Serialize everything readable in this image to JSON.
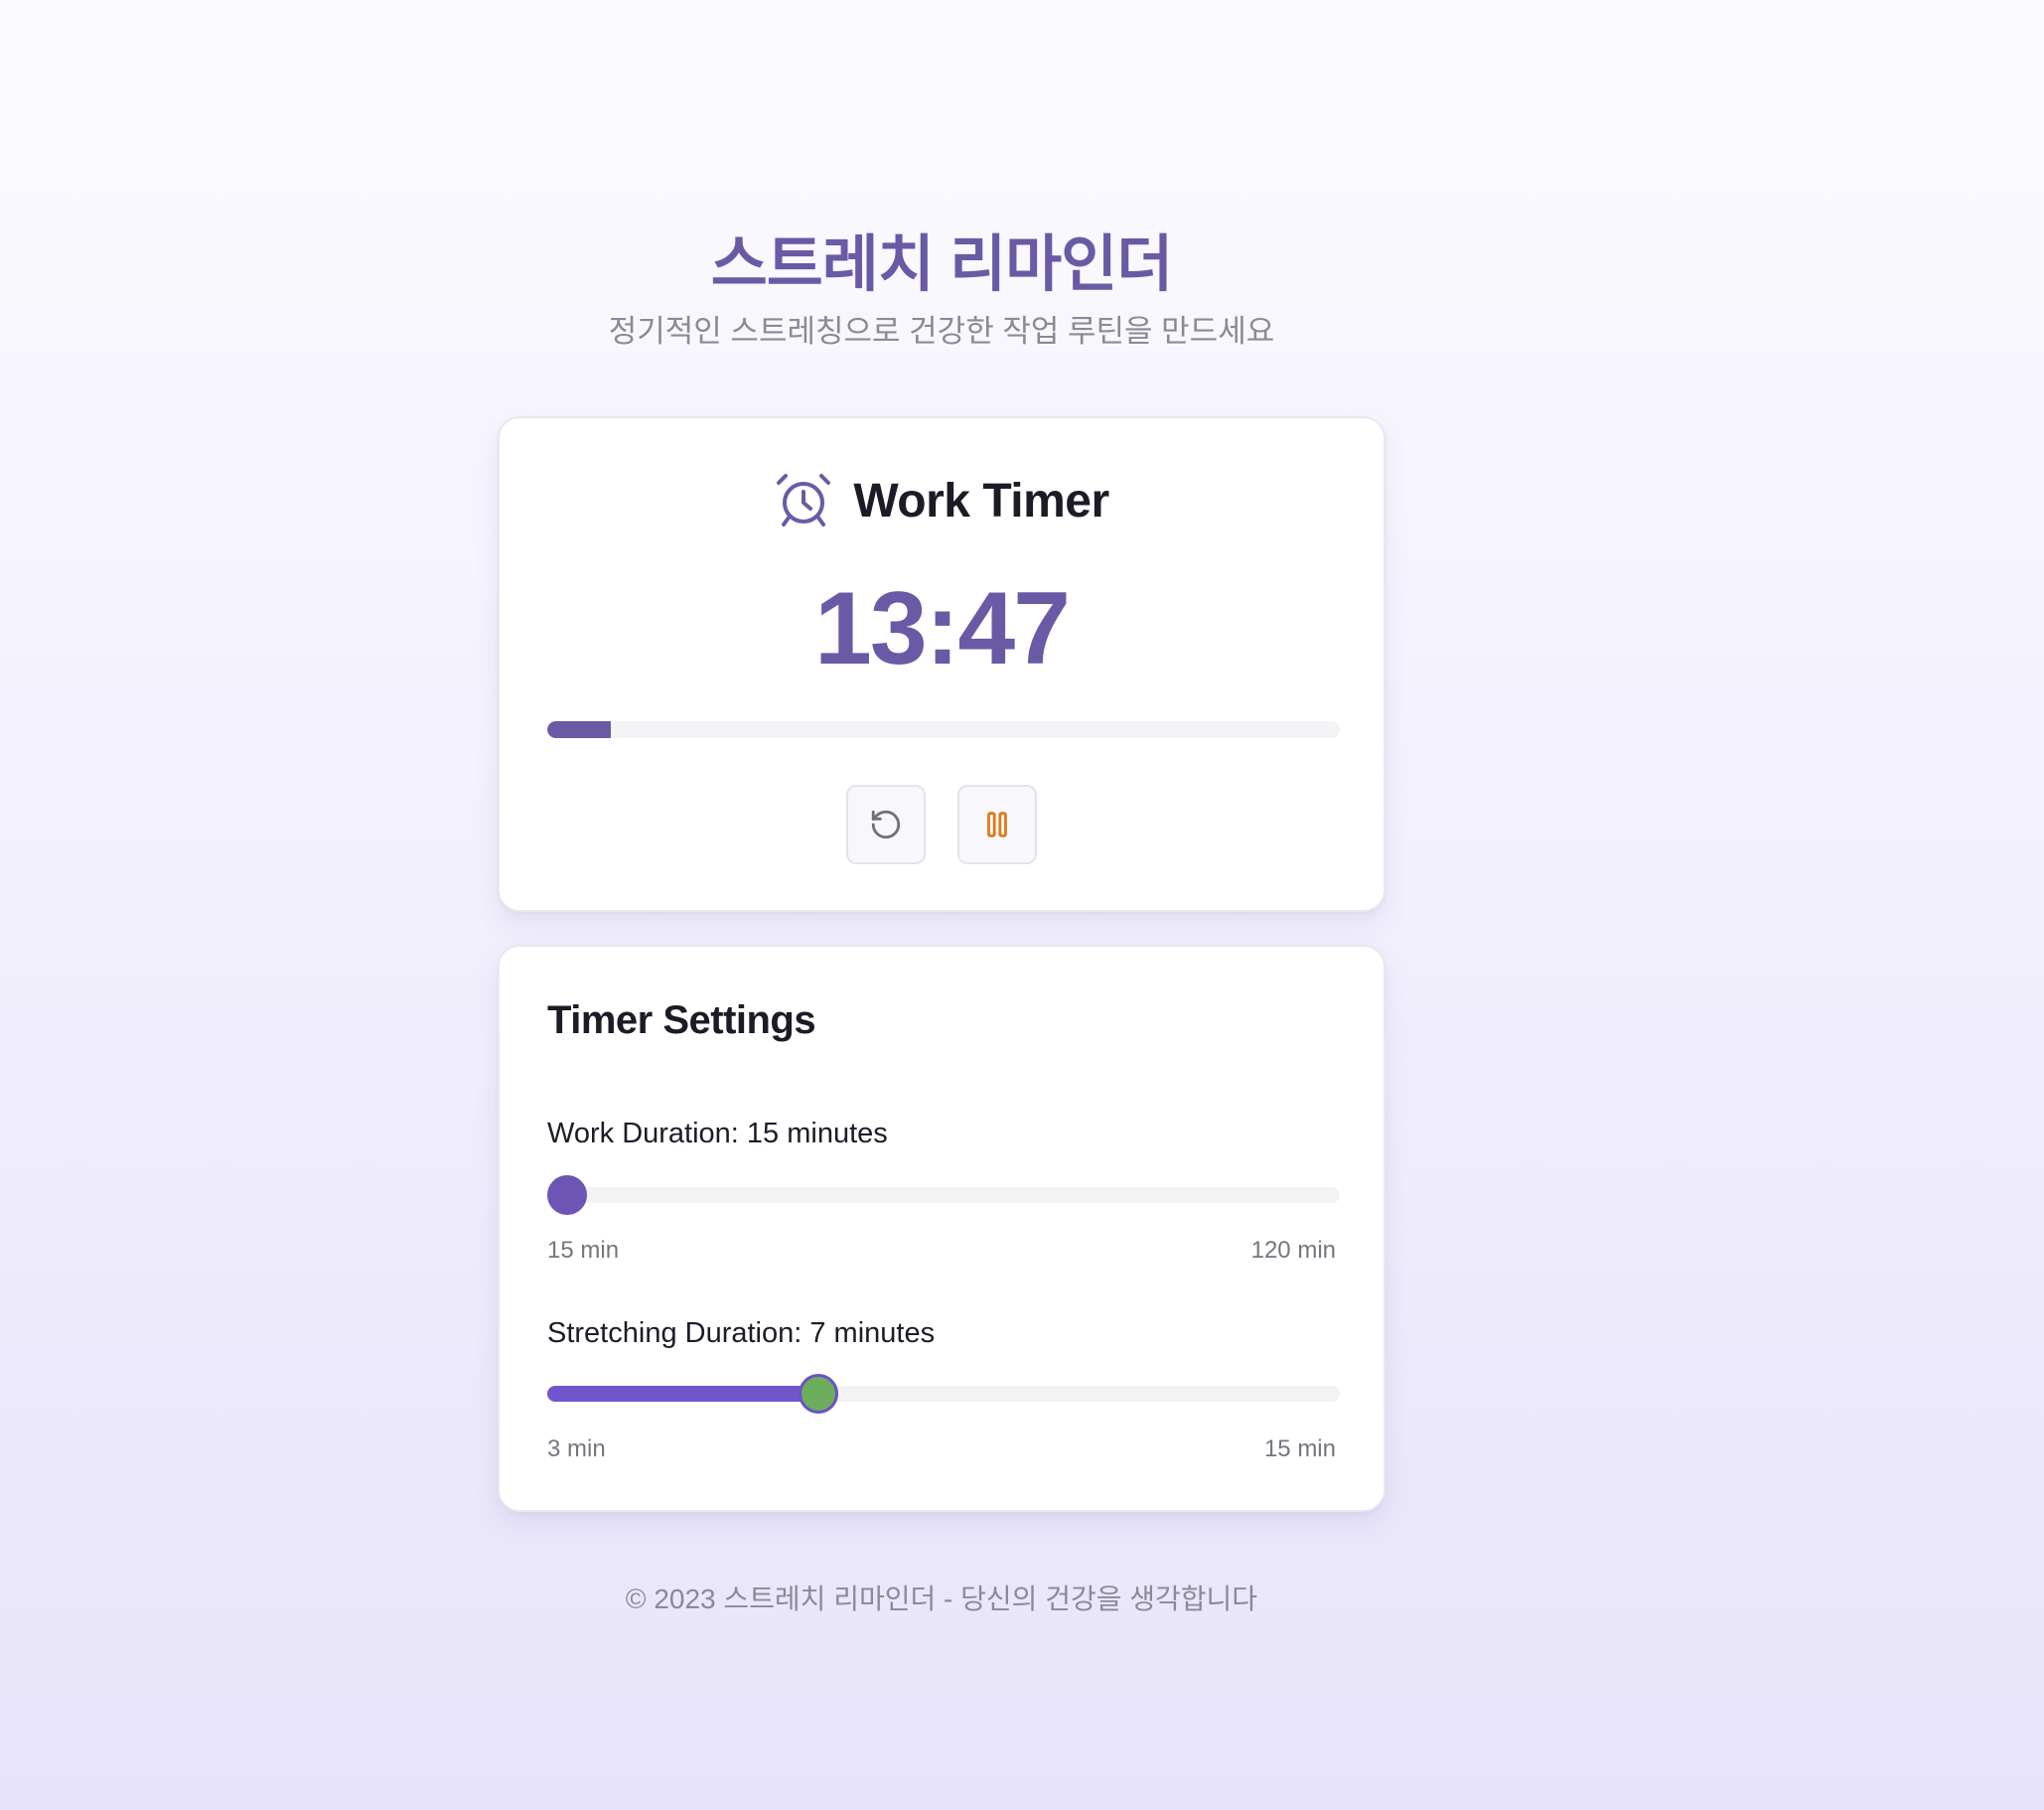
{
  "header": {
    "title": "스트레치 리마인더",
    "subtitle": "정기적인 스트레칭으로 건강한 작업 루틴을 만드세요"
  },
  "timer": {
    "icon": "alarm-clock-icon",
    "title": "Work Timer",
    "time": "13:47",
    "progress": 0.08,
    "reset_icon": "reset-icon",
    "pause_icon": "pause-icon"
  },
  "settings": {
    "title": "Timer Settings",
    "work": {
      "label": "Work Duration: 15 minutes",
      "value": 15,
      "min": 15,
      "max": 120,
      "min_label": "15 min",
      "max_label": "120 min"
    },
    "stretch": {
      "label": "Stretching Duration: 7 minutes",
      "value": 7,
      "min": 3,
      "max": 15,
      "min_label": "3 min",
      "max_label": "15 min"
    }
  },
  "footer": {
    "text": "© 2023 스트레치 리마인더 - 당신의 건강을 생각합니다"
  },
  "colors": {
    "accent": "#6a5aa6",
    "slider_fill": "#7055cc",
    "pause": "#e07a1f",
    "thumb_active": "#6bad5a"
  }
}
